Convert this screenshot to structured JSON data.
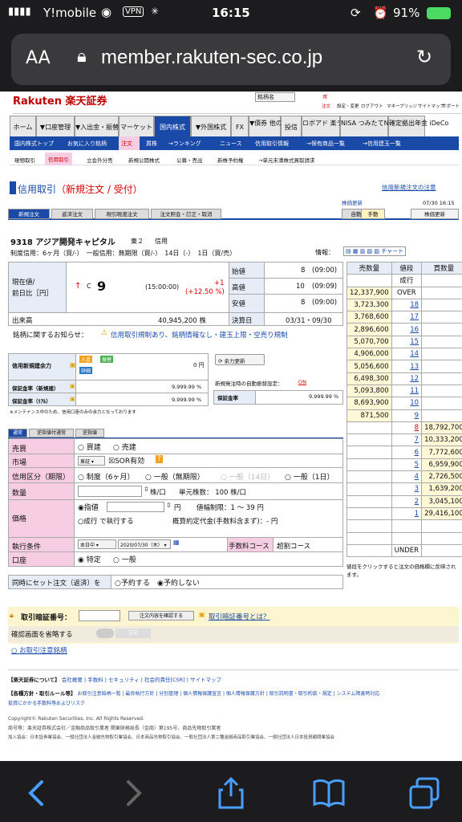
{
  "status": {
    "carrier": "Y!mobile",
    "vpn": "VPN",
    "time": "16:15",
    "battery": "91%"
  },
  "browser": {
    "aa": "AA",
    "url": "member.rakuten-sec.co.jp"
  },
  "site": {
    "logo": "Rakuten 楽天証券",
    "search_value": "銘柄名",
    "header_links": [
      "注文",
      "設定・変更",
      "ログアウト",
      "マネーブリッジ",
      "サイトマップ",
      "サポート"
    ]
  },
  "nav": [
    "ホーム",
    "▼口座管理",
    "▼入出金・振替",
    "マーケット",
    "国内株式",
    "▼外国株式",
    "FX",
    "▼債券 他の商品",
    "投信",
    "ロボアド 楽ラップ",
    "NISA つみたてNISA",
    "確定拠出年金 iDeCo"
  ],
  "subnav": [
    "国内株式トップ",
    "お気に入り銘柄",
    "注文",
    "買株",
    "→ランキング",
    "ニュース",
    "信用取引情報",
    "→保有商品一覧",
    "→信用建玉一覧"
  ],
  "subnav2": [
    "現物取引",
    "信用取引",
    "立会外分売",
    "新規公開株式",
    "公募・売出",
    "新株予約権",
    "→単元未満株式買取請求"
  ],
  "title": {
    "main": "信用取引",
    "sub": "（新規注文 / 受付）",
    "help": "信用新規注文の注意",
    "update": "株価更新",
    "date": "07/30 16:15",
    "auto": "自動",
    "manual": "手動",
    "refresh": "株価更新"
  },
  "tabs": [
    "新規注文",
    "返済注文",
    "現引現渡注文",
    "注文照会・訂正・取消"
  ],
  "stock": {
    "code_name": "9318 アジア開発キャピタル",
    "market": "東２",
    "type": "信用",
    "conditions": "制度信用：6ヶ月（買/-）　一般信用：無期限（買/-）　14日（-）　1日（買/売）",
    "info": "情報：",
    "chart": "チャート"
  },
  "quote": {
    "label1": "現在値/",
    "label2": "前日比［円］",
    "arrow": "↑",
    "c": "C",
    "price": "9",
    "time": "(15:00:00)",
    "change": "+1",
    "change_pct": "(+12.50 %)",
    "volume_label": "出来高",
    "volume": "40,945,200 株",
    "open_label": "始値",
    "open": "8",
    "open_t": "(09:00)",
    "high_label": "高値",
    "high": "10",
    "high_t": "(09:09)",
    "low_label": "安値",
    "low": "8",
    "low_t": "(09:00)",
    "settle_label": "決算日",
    "settle": "03/31・09/30"
  },
  "notice": {
    "label": "銘柄に関するお知らせ：",
    "text": "信用取引規制あり、銘柄情報なし・建玉上限・空売り規制"
  },
  "margin": {
    "title": "信用新規建余力",
    "zero": "0 円",
    "refresh": "余力更新",
    "rate1_label": "保証金率（新規建）",
    "rate1": "9,999.99 %",
    "rate2_label": "保証金率（ﾘｱﾙ）",
    "rate2": "9,999.99 %",
    "auto_label": "新規発注時の自動振替設定：",
    "auto_val": "ON",
    "rate3_label": "保証金率",
    "rate3": "9,999.99 %",
    "note": "※メンテナンス中のため、信用口座のみの余力となっております",
    "badges": [
      "入金",
      "振替",
      "詳細"
    ]
  },
  "ordertabs": [
    "通常",
    "逆指値付通常",
    "逆指値"
  ],
  "form": {
    "l_trade": "売買",
    "buy": "買建",
    "sell": "売建",
    "l_market": "市場",
    "market_sel": "東証",
    "sor": "SOR有効",
    "l_type": "信用区分（期限）",
    "t1": "制度（6ヶ月）",
    "t2": "一般（無期限）",
    "t3": "一般（14日）",
    "t4": "一般（1日）",
    "l_qty": "数量",
    "qty_unit": "株/口",
    "unit": "単元株数： 100 株/口",
    "l_price": "価格",
    "limit": "指値",
    "yen": "円",
    "range": "値幅制限：1 〜 39 円",
    "cond": "成行 で執行する",
    "approx": "概算約定代金(手数料含まず)：- 円",
    "l_exec": "執行条件",
    "exec_sel": "本日中",
    "date_sel": "2020/07/30（木）",
    "fee_label": "手数料コース",
    "fee": "超割コース",
    "l_acct": "口座",
    "acct1": "特定",
    "acct2": "一般"
  },
  "setorder": {
    "label": "同時にセット注文（返済）を",
    "yes": "予約する",
    "no": "予約しない"
  },
  "pin": {
    "label": "取引暗証番号：",
    "confirm": "注文内容を確認する",
    "help": "取引暗証番号とは？",
    "skip": "確認画面を省略する",
    "place": "注文"
  },
  "notes_link": "お取引注意銘柄",
  "board": {
    "h_sell": "売数量",
    "h_price": "値段",
    "h_buy": "買数量",
    "nariyuki": "成行",
    "sells": [
      [
        "12,337,900",
        "OVER"
      ],
      [
        "3,723,300",
        "18"
      ],
      [
        "3,768,600",
        "17"
      ],
      [
        "2,896,600",
        "16"
      ],
      [
        "5,070,700",
        "15"
      ],
      [
        "4,906,000",
        "14"
      ],
      [
        "5,056,600",
        "13"
      ],
      [
        "6,498,300",
        "12"
      ],
      [
        "5,093,800",
        "11"
      ],
      [
        "8,693,900",
        "10"
      ],
      [
        "871,500",
        "9"
      ]
    ],
    "buys": [
      [
        "8",
        "18,792,700"
      ],
      [
        "7",
        "10,333,200"
      ],
      [
        "6",
        "7,772,600"
      ],
      [
        "5",
        "6,959,900"
      ],
      [
        "4",
        "2,726,500"
      ],
      [
        "3",
        "1,639,200"
      ],
      [
        "2",
        "3,045,100"
      ],
      [
        "1",
        "29,416,100"
      ]
    ],
    "under": "UNDER",
    "note": "値段をクリックすると注文の価格欄に反映されます。"
  },
  "footer": {
    "l1": "【楽天証券について】",
    "l1items": "会社概要 | 手数料 | セキュリティ | 社会的責任[CSR] | サイトマップ",
    "l2": "【各種方針・取引ルール等】",
    "l2items": "お取引注意銘柄一覧 | 最良執行方針 | 分別管理 | 個人情報保護宣言 | 個人情報保護方針 | 取引説明書・取引約款・規定 | システム障害時対応",
    "l2b": "投資にかかる手数料等およびリスク",
    "copy": "Copyright© Rakuten Securities, Inc. All Rights Reserved.",
    "reg": "商号等：楽天証券株式会社／金融商品取引業者 関東財務局長（金商）第195号、商品先物取引業者",
    "assoc": "加入協会：日本証券業協会、一般社団法人金融先物取引業協会、日本商品先物取引協会、一般社団法人第二種金融商品取引業協会、一般社団法人日本投資顧問業協会"
  },
  "colors": {
    "nav_blue": "#1a4aa8",
    "red": "#d40000",
    "pink": "#f6cde3"
  }
}
